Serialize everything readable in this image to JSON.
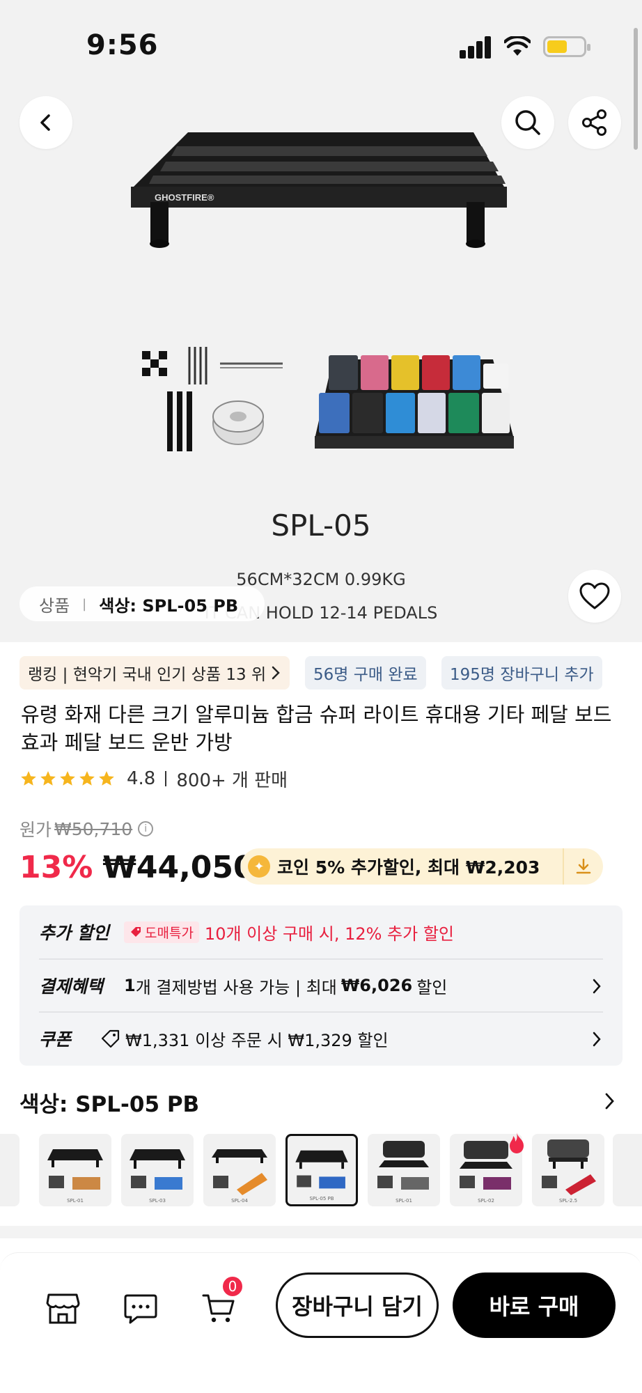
{
  "status_bar": {
    "time": "9:56"
  },
  "hero": {
    "brand": "GHOSTFIRE®",
    "model": "SPL-05",
    "dims": "56CM*32CM 0.99KG",
    "capacity": "IT CAN HOLD 12-14 PEDALS",
    "chip_label": "상품",
    "chip_sep": "|",
    "chip_value": "색상: SPL-05 PB"
  },
  "tags": {
    "ranking": "랭킹 | 현악기 국내 인기 상품 13 위",
    "purchased": "56명 구매 완료",
    "cart_added": "195명 장바구니 추가"
  },
  "product": {
    "title": "유령 화재 다른 크기 알루미늄 합금 슈퍼 라이트 휴대용 기타 페달 보드 효과 페달 보드 운반 가방",
    "rating": "4.8",
    "sold": "800+ 개 판매",
    "rating_value": 4.8
  },
  "price": {
    "original_label": "원가",
    "original_price": "₩50,710",
    "discount": "13%",
    "current": "₩44,050",
    "coin_text": "코인 5% 추가할인, 최대 ₩2,203"
  },
  "benefits": {
    "extra_label": "추가 할인",
    "wholesale_badge": "도매특가",
    "extra_text": "10개 이상 구매 시, 12% 추가 할인",
    "payment_label": "결제혜택",
    "payment_count": "1",
    "payment_text": "개 결제방법 사용 가능 | 최대",
    "payment_max": "₩6,026",
    "payment_suffix": "할인",
    "coupon_label": "쿠폰",
    "coupon_text": "₩1,331 이상 주문 시 ₩1,329 할인"
  },
  "color_section": {
    "title": "색상: SPL-05 PB",
    "options": [
      {
        "caption": "SPL-01"
      },
      {
        "caption": "SPL-03"
      },
      {
        "caption": "SPL-04"
      },
      {
        "caption": "SPL-05 PB"
      },
      {
        "caption": "SPL-01"
      },
      {
        "caption": "SPL-02"
      },
      {
        "caption": "SPL-2.5"
      }
    ]
  },
  "bottom_bar": {
    "cart_count": "0",
    "add_to_cart": "장바구니 담기",
    "buy_now": "바로 구매"
  },
  "colors": {
    "accent_red": "#f0294a",
    "star": "#f6b51e",
    "coin_bg": "#fdf2d6",
    "tag_blue": "#3b5b87"
  }
}
